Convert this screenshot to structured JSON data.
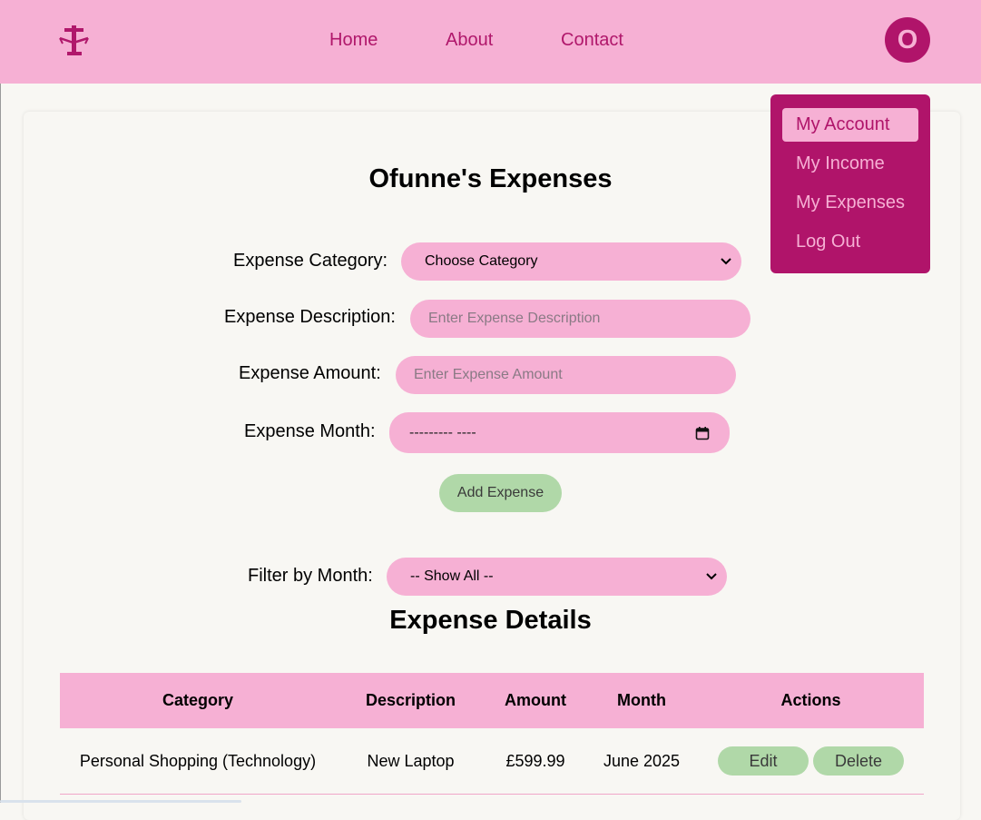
{
  "nav": {
    "links": [
      "Home",
      "About",
      "Contact"
    ],
    "avatar_initial": "O",
    "logo_icon": "scales-logo-icon"
  },
  "user_menu": {
    "items": [
      "My Account",
      "My Income",
      "My Expenses",
      "Log Out"
    ],
    "active": "My Account"
  },
  "form": {
    "title": "Ofunne's Expenses",
    "category_label": "Expense Category:",
    "category_value": "Choose Category",
    "description_label": "Expense Description:",
    "description_placeholder": "Enter Expense Description",
    "amount_label": "Expense Amount:",
    "amount_placeholder": "Enter Expense Amount",
    "month_label": "Expense Month:",
    "month_value": "--------- ----",
    "submit_label": "Add Expense"
  },
  "filter": {
    "label": "Filter by Month:",
    "value": "-- Show All --"
  },
  "table": {
    "title": "Expense Details",
    "headers": [
      "Category",
      "Description",
      "Amount",
      "Month",
      "Actions"
    ],
    "rows": [
      {
        "category": "Personal Shopping (Technology)",
        "description": "New Laptop",
        "amount": "£599.99",
        "month": "June 2025",
        "edit_label": "Edit",
        "delete_label": "Delete"
      }
    ]
  },
  "colors": {
    "pink": "#f6b0d4",
    "magenta": "#b0146a",
    "green": "#b0d8a8",
    "background": "#f8f7f3"
  }
}
